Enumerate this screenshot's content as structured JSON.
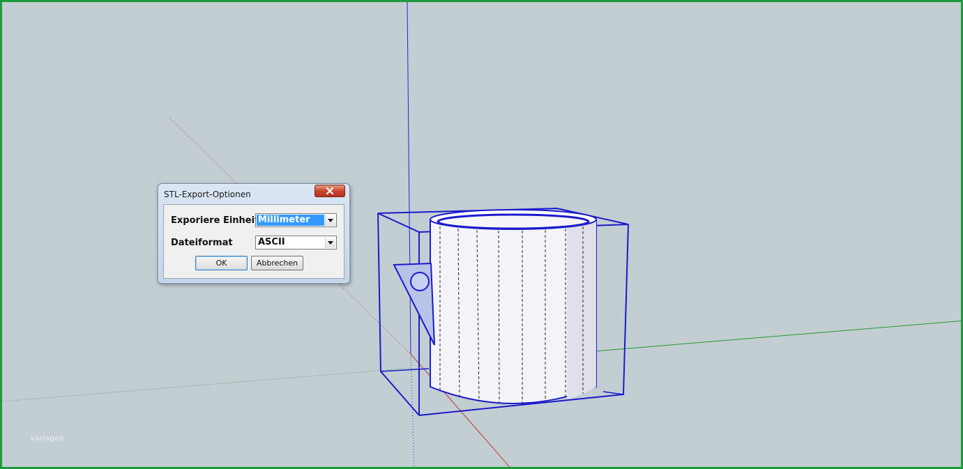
{
  "dialog": {
    "title": "STL-Export-Optionen",
    "unit_label": "Exporiere Einheit:",
    "unit_value": "Millimeter",
    "format_label": "Dateiformat",
    "format_value": "ASCII",
    "ok_label": "OK",
    "cancel_label": "Abbrechen"
  },
  "watermark": "vorlagen",
  "colors": {
    "viewport_background": "#c3ced3",
    "frame_border": "#1e9a3c",
    "model_edges": "#1a1acc",
    "axis_red": "#c0392b",
    "axis_green": "#1f9a2e",
    "axis_blue": "#2222dd",
    "selection_highlight": "#3399ff"
  },
  "icons": {
    "close": "close-icon",
    "dropdown": "chevron-down-icon"
  }
}
